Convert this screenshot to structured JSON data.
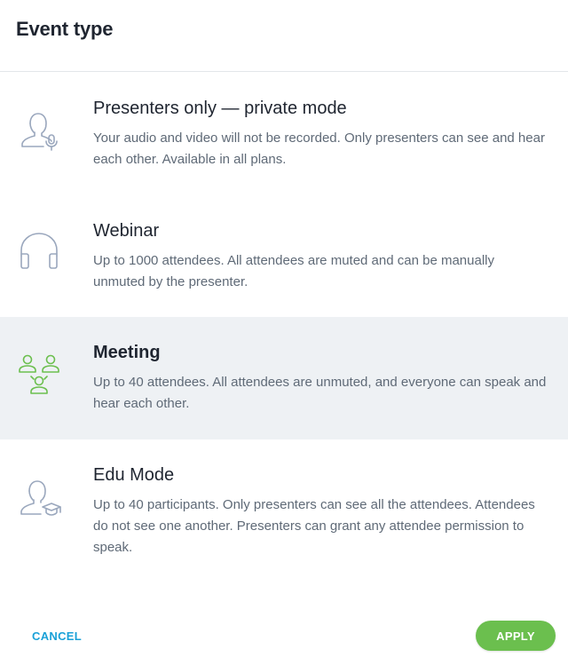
{
  "header": {
    "title": "Event type"
  },
  "options": [
    {
      "title": "Presenters only — private mode",
      "description": "Your audio and video will not be recorded. Only presenters can see and hear each other. Available in all plans.",
      "icon": "presenter-mic-icon",
      "selected": false
    },
    {
      "title": "Webinar",
      "description": "Up to 1000 attendees. All attendees are muted and can be manually unmuted by the presenter.",
      "icon": "headphones-icon",
      "selected": false
    },
    {
      "title": "Meeting",
      "description": "Up to 40 attendees. All attendees are unmuted, and everyone can speak and hear each other.",
      "icon": "group-icon",
      "selected": true
    },
    {
      "title": "Edu Mode",
      "description": "Up to 40 participants. Only presenters can see all the attendees. Attendees do not see one another. Presenters can grant any attendee permission to speak.",
      "icon": "graduate-icon",
      "selected": false
    }
  ],
  "footer": {
    "cancel_label": "CANCEL",
    "apply_label": "APPLY"
  },
  "colors": {
    "accent_blue": "#1aa1d8",
    "accent_green": "#6bbf4e",
    "selected_bg": "#eef1f4",
    "icon_gray": "#9aa7bd"
  }
}
